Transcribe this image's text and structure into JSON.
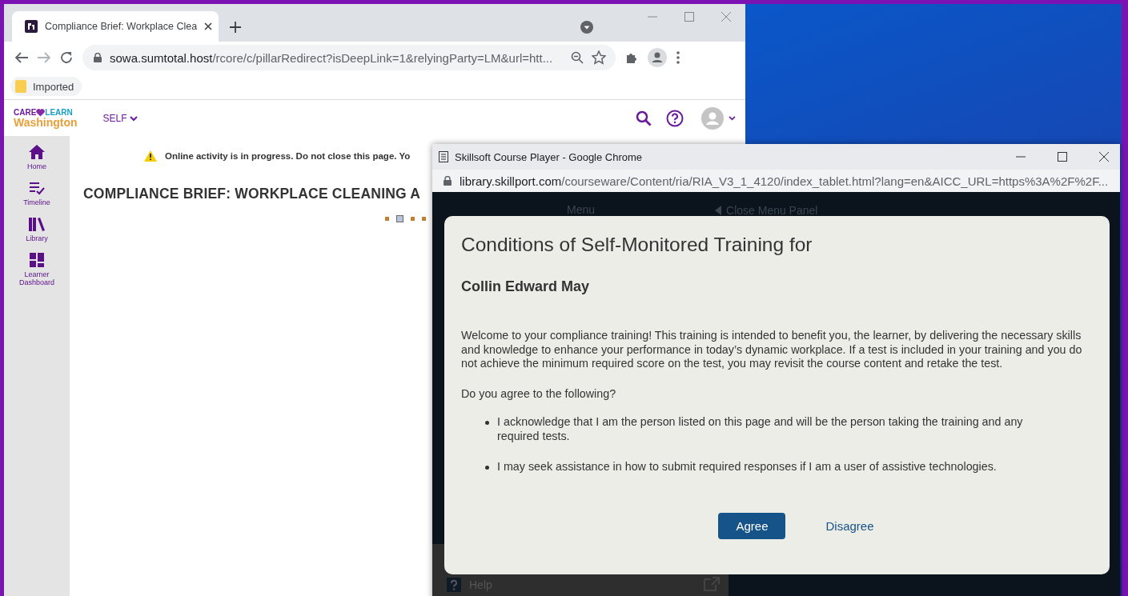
{
  "browser": {
    "tab_title": "Compliance Brief: Workplace Clea",
    "address_host": "sowa.sumtotal.host",
    "address_path": "/rcore/c/pillarRedirect?isDeepLink=1&relyingParty=LM&url=htt...",
    "bookmarks": [
      "Imported"
    ]
  },
  "site": {
    "logo_care": "CARE",
    "logo_learn": "LEARN",
    "logo_state": "Washington",
    "menu": "SELF",
    "nav": [
      {
        "label": "Home",
        "kind": "home"
      },
      {
        "label": "Timeline",
        "kind": "timeline"
      },
      {
        "label": "Library",
        "kind": "library"
      },
      {
        "label": "Learner Dashboard",
        "kind": "dashboard"
      }
    ],
    "warning": "Online activity is in progress. Do not close this page. Yo",
    "title": "COMPLIANCE BRIEF: WORKPLACE CLEANING A",
    "loader_dots": [
      {
        "selected": false
      },
      {
        "selected": true
      },
      {
        "selected": false
      },
      {
        "selected": false
      }
    ]
  },
  "popup": {
    "title": "Skillsoft Course Player - Google Chrome",
    "address_host": "library.skillport.com",
    "address_path": "/courseware/Content/ria/RIA_V3_1_4120/index_tablet.html?lang=en&AICC_URL=https%3A%2F%2F...",
    "menu_label": "Menu",
    "close_panel": "Close Menu Panel",
    "help": "Help"
  },
  "dialog": {
    "heading": "Conditions of Self-Monitored Training for",
    "name": "Collin Edward May",
    "paragraph": "Welcome to your compliance training! This training is intended to benefit you, the learner, by delivering the necessary skills and knowledge to enhance your performance in today’s dynamic workplace. If a test is included in your training and you do not achieve the minimum required score on the test, you may revisit the course content and retake the test.",
    "question": "Do you agree to the following?",
    "bullets": [
      "I acknowledge that I am the person listed on this page and will be the person taking the training and any required tests.",
      "I may seek assistance in how to submit required responses if I am a user of assistive technologies."
    ],
    "buttons": [
      {
        "label": "Agree",
        "kind": "primary"
      },
      {
        "label": "Disagree",
        "kind": "link"
      }
    ]
  }
}
